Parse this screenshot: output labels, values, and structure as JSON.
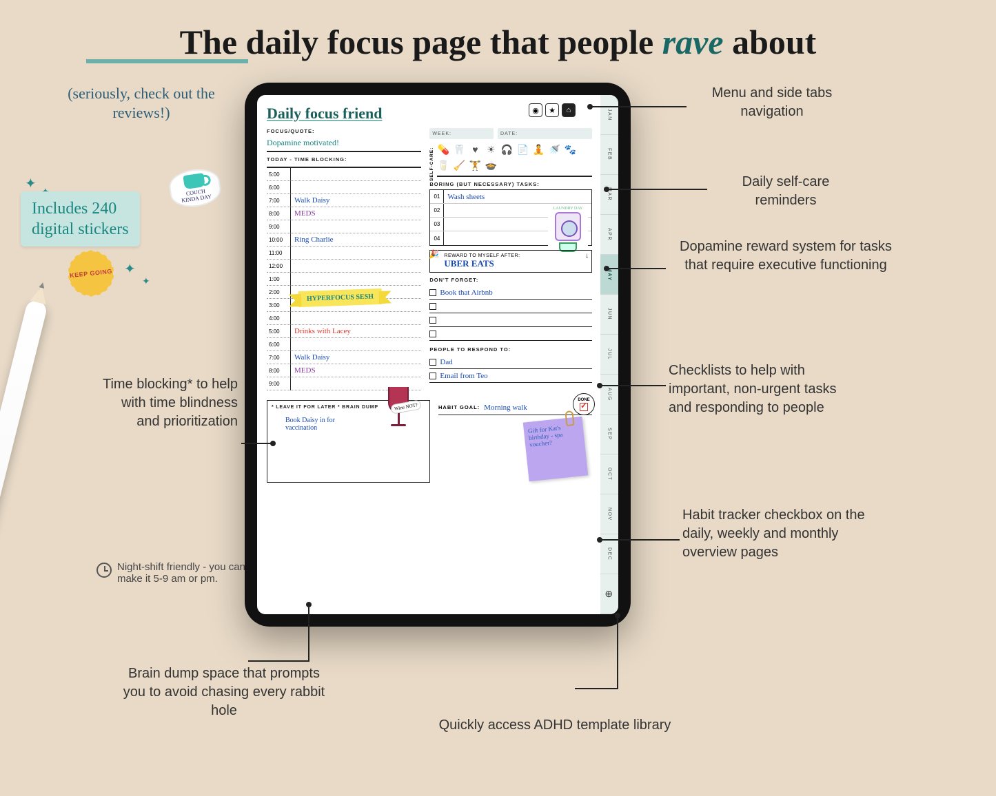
{
  "headline": {
    "pre": "The daily focus page that people ",
    "em": "rave",
    "post": " about"
  },
  "subhead": "(seriously, check out the reviews!)",
  "stickers_promo": {
    "line1": "Includes 240",
    "line2": "digital stickers",
    "cup_label1": "COUCH",
    "cup_label2": "KINDA DAY",
    "keep_going": "KEEP GOING"
  },
  "callouts": {
    "menu": "Menu and side tabs navigation",
    "selfcare": "Daily self-care reminders",
    "dopamine": "Dopamine reward system for tasks that require executive functioning",
    "checklists": "Checklists to help with important, non-urgent tasks and responding to people",
    "habit": "Habit tracker checkbox on the daily, weekly and monthly overview pages",
    "library": "Quickly access ADHD template library",
    "braindump": "Brain dump space that prompts you to avoid chasing every rabbit hole",
    "timeblock": "Time blocking* to help with time blindness and prioritization",
    "night": "Night-shift friendly - you can make it 5-9 am or pm."
  },
  "planner": {
    "title": "Daily focus friend",
    "focus_label": "FOCUS/QUOTE:",
    "focus_value": "Dopamine motivated!",
    "timeblock_label": "TODAY - TIME BLOCKING:",
    "times": [
      "5:00",
      "6:00",
      "7:00",
      "8:00",
      "9:00",
      "10:00",
      "11:00",
      "12:00",
      "1:00",
      "2:00",
      "3:00",
      "4:00",
      "5:00",
      "6:00",
      "7:00",
      "8:00",
      "9:00"
    ],
    "time_entries": {
      "7:00": "Walk Daisy",
      "8:00": "MEDS",
      "10:00": "Ring Charlie",
      "12:00": "",
      "5:00b": "Drinks with Lacey"
    },
    "hyper": "HYPERFOCUS SESH",
    "wine_tag": "Wine NOT?",
    "week_label": "WEEK:",
    "date_label": "DATE:",
    "selfcare_label": "SELF-CARE:",
    "boring_label": "BORING (BUT NECESSARY) TASKS:",
    "boring": [
      "Wash sheets",
      "",
      "",
      ""
    ],
    "laundry_tag": "LAUNDRY DAY",
    "reward_label": "REWARD TO MYSELF AFTER:",
    "reward_value": "UBER EATS",
    "dontforget_label": "DON'T FORGET:",
    "dontforget": [
      "Book that Airbnb",
      "",
      "",
      ""
    ],
    "respond_label": "PEOPLE TO RESPOND TO:",
    "respond": [
      "Dad",
      "Email from Teo"
    ],
    "brain_label": "* LEAVE IT FOR LATER * BRAIN DUMP",
    "brain_value": "Book Daisy in for vaccination",
    "habit_label": "HABIT GOAL:",
    "habit_value": "Morning walk",
    "done": "DONE",
    "sticky": "Gift for Kat's birthday - spa voucher?",
    "months": [
      "JAN",
      "FEB",
      "MAR",
      "APR",
      "MAY",
      "JUN",
      "JUL",
      "AUG",
      "SEP",
      "OCT",
      "NOV",
      "DEC"
    ],
    "active_month": "MAY"
  }
}
